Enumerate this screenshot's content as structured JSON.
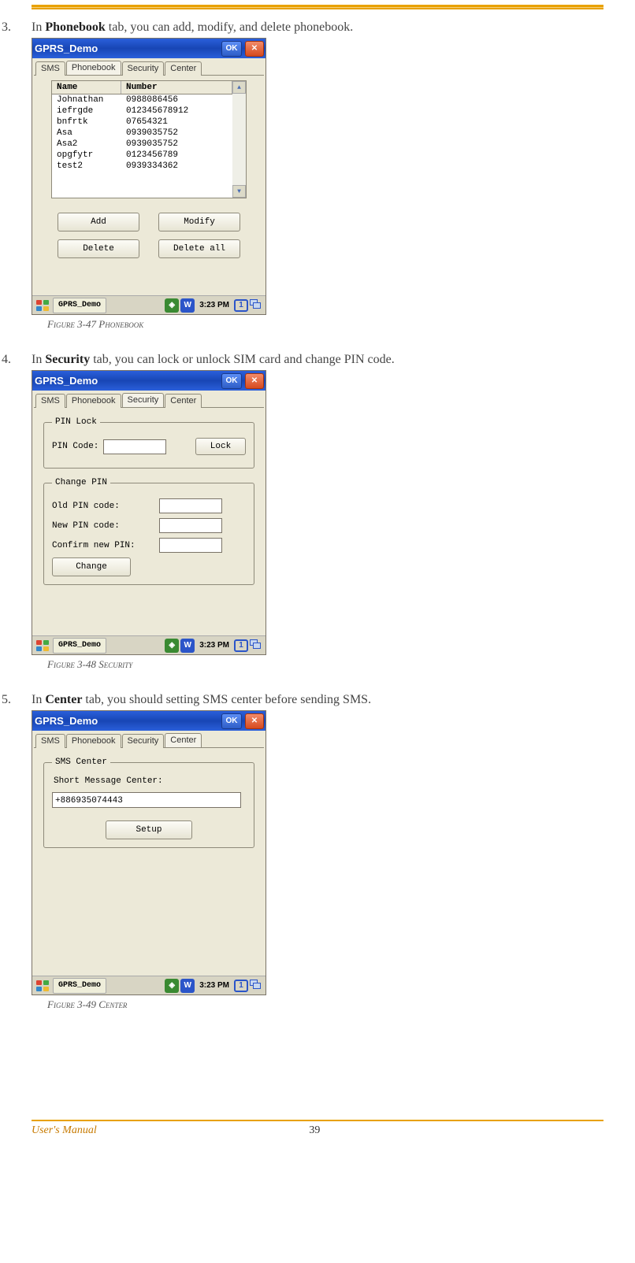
{
  "items": [
    {
      "num": "3.",
      "pre": "In ",
      "bold": "Phonebook",
      "post": " tab, you can add, modify, and delete phonebook.",
      "caption": "Figure 3-47 Phonebook"
    },
    {
      "num": "4.",
      "pre": "In ",
      "bold": "Security",
      "post": " tab, you can lock or unlock SIM card and change PIN code.",
      "caption": "Figure 3-48 Security"
    },
    {
      "num": "5.",
      "pre": "In ",
      "bold": "Center",
      "post": " tab, you should setting SMS center before sending SMS.",
      "caption": "Figure 3-49 Center"
    }
  ],
  "window": {
    "title": "GPRS_Demo",
    "ok": "OK",
    "close": "✕",
    "tabs": {
      "sms": "SMS",
      "phonebook": "Phonebook",
      "security": "Security",
      "center": "Center"
    }
  },
  "phonebook": {
    "headers": {
      "name": "Name",
      "number": "Number"
    },
    "rows": [
      {
        "name": "Johnathan",
        "number": "0988086456"
      },
      {
        "name": "iefrgde",
        "number": "012345678912"
      },
      {
        "name": "bnfrtk",
        "number": "07654321"
      },
      {
        "name": "Asa",
        "number": "0939035752"
      },
      {
        "name": "Asa2",
        "number": "0939035752"
      },
      {
        "name": "opgfytr",
        "number": "0123456789"
      },
      {
        "name": "test2",
        "number": "0939334362"
      }
    ],
    "buttons": {
      "add": "Add",
      "modify": "Modify",
      "delete": "Delete",
      "delete_all": "Delete all"
    }
  },
  "security": {
    "groups": {
      "pin_lock": "PIN Lock",
      "change_pin": "Change PIN"
    },
    "labels": {
      "pin_code": "PIN Code:",
      "old_pin": "Old PIN code:",
      "new_pin": "New PIN code:",
      "confirm_pin": "Confirm new PIN:"
    },
    "buttons": {
      "lock": "Lock",
      "change": "Change"
    }
  },
  "center": {
    "group": "SMS Center",
    "label": "Short Message Center:",
    "value": "+886935074443",
    "button": "Setup"
  },
  "taskbar": {
    "app": "GPRS_Demo",
    "time": "3:23 PM",
    "icons": {
      "wifi": "◈",
      "w": "W",
      "one": "1"
    }
  },
  "footer": {
    "label": "User's Manual",
    "page": "39"
  }
}
